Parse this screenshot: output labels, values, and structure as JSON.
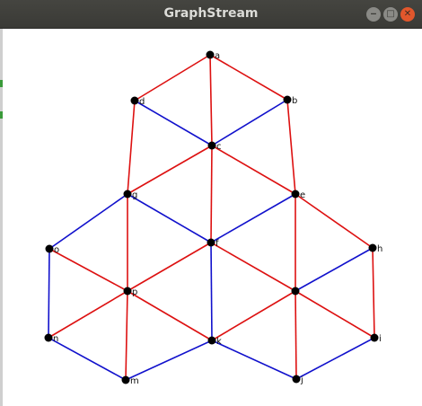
{
  "window": {
    "title": "GraphStream",
    "minimize_label": "‒",
    "maximize_label": "□",
    "close_label": "✕"
  },
  "graph": {
    "colors": {
      "red": "#dd1111",
      "blue": "#1111cc",
      "node": "#000000"
    },
    "nodes": [
      {
        "id": "a",
        "label": "a"
      },
      {
        "id": "b",
        "label": "b"
      },
      {
        "id": "c",
        "label": "c"
      },
      {
        "id": "d",
        "label": "d"
      },
      {
        "id": "e",
        "label": "e"
      },
      {
        "id": "f",
        "label": "f"
      },
      {
        "id": "g",
        "label": "g"
      },
      {
        "id": "h",
        "label": "h"
      },
      {
        "id": "i",
        "label": "i"
      },
      {
        "id": "j",
        "label": "j"
      },
      {
        "id": "k",
        "label": "k"
      },
      {
        "id": "m",
        "label": "m"
      },
      {
        "id": "n",
        "label": "n"
      },
      {
        "id": "o",
        "label": "o"
      },
      {
        "id": "p",
        "label": "p"
      }
    ],
    "edges": [
      {
        "from": "a",
        "to": "d",
        "color": "red"
      },
      {
        "from": "a",
        "to": "b",
        "color": "red"
      },
      {
        "from": "a",
        "to": "c",
        "color": "red"
      },
      {
        "from": "d",
        "to": "c",
        "color": "blue"
      },
      {
        "from": "b",
        "to": "c",
        "color": "blue"
      },
      {
        "from": "d",
        "to": "g",
        "color": "red"
      },
      {
        "from": "b",
        "to": "e",
        "color": "red"
      },
      {
        "from": "c",
        "to": "g",
        "color": "red"
      },
      {
        "from": "c",
        "to": "e",
        "color": "red"
      },
      {
        "from": "c",
        "to": "f",
        "color": "red"
      },
      {
        "from": "g",
        "to": "f",
        "color": "blue"
      },
      {
        "from": "e",
        "to": "f",
        "color": "blue"
      },
      {
        "from": "g",
        "to": "o",
        "color": "blue"
      },
      {
        "from": "g",
        "to": "p",
        "color": "red"
      },
      {
        "from": "e",
        "to": "h",
        "color": "red"
      },
      {
        "from": "e",
        "to": "l",
        "color": "red"
      },
      {
        "from": "f",
        "to": "p",
        "color": "red"
      },
      {
        "from": "f",
        "to": "l",
        "color": "red"
      },
      {
        "from": "f",
        "to": "k",
        "color": "blue"
      },
      {
        "from": "o",
        "to": "p",
        "color": "red"
      },
      {
        "from": "o",
        "to": "n",
        "color": "blue"
      },
      {
        "from": "h",
        "to": "l",
        "color": "blue"
      },
      {
        "from": "h",
        "to": "i",
        "color": "red"
      },
      {
        "from": "p",
        "to": "n",
        "color": "red"
      },
      {
        "from": "p",
        "to": "m",
        "color": "red"
      },
      {
        "from": "p",
        "to": "k",
        "color": "red"
      },
      {
        "from": "l",
        "to": "k",
        "color": "red"
      },
      {
        "from": "l",
        "to": "i",
        "color": "red"
      },
      {
        "from": "l",
        "to": "j",
        "color": "red"
      },
      {
        "from": "n",
        "to": "m",
        "color": "blue"
      },
      {
        "from": "m",
        "to": "k",
        "color": "blue"
      },
      {
        "from": "k",
        "to": "j",
        "color": "blue"
      },
      {
        "from": "j",
        "to": "i",
        "color": "blue"
      }
    ]
  }
}
